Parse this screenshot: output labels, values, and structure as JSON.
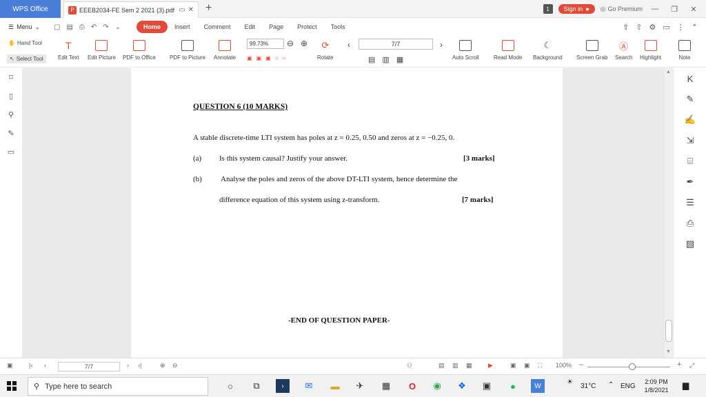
{
  "titlebar": {
    "app_name": "WPS Office",
    "doc_tab_title": "EEEB2034-FE Sem 2 2021 (3).pdf",
    "pdf_badge": "P",
    "notification_count": "1",
    "sign_in_label": "Sign in",
    "go_premium_label": "Go Premium"
  },
  "menu": {
    "menu_label": "Menu",
    "tabs": [
      "Home",
      "Insert",
      "Comment",
      "Edit",
      "Page",
      "Protect",
      "Tools"
    ],
    "active_tab": "Home"
  },
  "toolbar": {
    "hand_tool": "Hand Tool",
    "select_tool": "Select Tool",
    "edit_text": "Edit Text",
    "edit_picture": "Edit Picture",
    "pdf_to_office": "PDF to Office",
    "pdf_to_picture": "PDF to Picture",
    "annotate": "Annotate",
    "zoom_value": "99.73%",
    "rotate": "Rotate",
    "page_value": "7/7",
    "auto_scroll": "Auto Scroll",
    "read_mode": "Read Mode",
    "background": "Background",
    "screen_grab": "Screen Grab",
    "search": "Search",
    "highlight": "Highlight",
    "note": "Note"
  },
  "document": {
    "question_title": "QUESTION 6 (10 MARKS)",
    "intro": "A stable discrete-time LTI system has poles at z = 0.25, 0.50 and zeros at z = −0.25, 0.",
    "part_a_label": "(a)",
    "part_a_text": "Is this system causal? Justify your answer.",
    "part_a_marks": "[3 marks]",
    "part_b_label": "(b)",
    "part_b_text_line1": "Analyse the poles and zeros of the above DT-LTI system, hence determine the",
    "part_b_text_line2": "difference equation of this system using z-transform.",
    "part_b_marks": "[7  marks]",
    "end_text": "-END OF QUESTION PAPER-"
  },
  "statusbar": {
    "page_value": "7/7",
    "zoom_label": "100%"
  },
  "taskbar": {
    "search_placeholder": "Type here to search",
    "temperature": "31°C",
    "language": "ENG",
    "time": "2:09 PM",
    "date": "1/8/2021"
  },
  "colors": {
    "accent_red": "#e04b3a",
    "app_blue": "#4a7fd8"
  }
}
